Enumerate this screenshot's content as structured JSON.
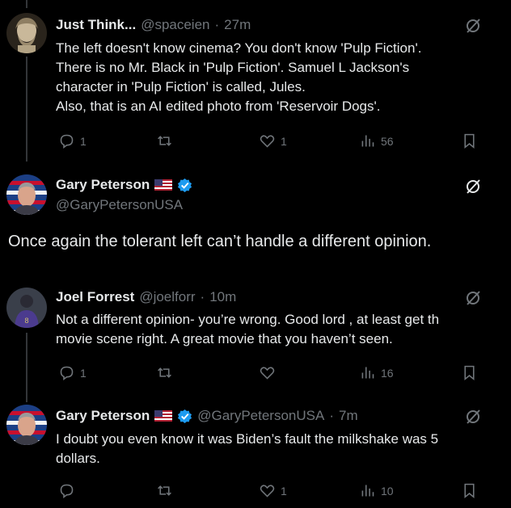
{
  "posts": [
    {
      "display_name": "Just Think...",
      "handle": "@spaceien",
      "time": "27m",
      "text_lines": [
        "The left doesn't know cinema? You don't know 'Pulp Fiction'.",
        "There is no Mr. Black in 'Pulp Fiction'. Samuel L Jackson's",
        "character in 'Pulp Fiction' is called, Jules.",
        "Also, that is an AI edited photo from 'Reservoir Dogs'."
      ],
      "replies": "1",
      "reposts": "",
      "likes": "1",
      "views": "56"
    },
    {
      "display_name": "Gary Peterson",
      "handle": "@GaryPetersonUSA",
      "text": "Once again the tolerant left can’t handle a different opinion."
    },
    {
      "display_name": "Joel Forrest",
      "handle": "@joelforr",
      "time": "10m",
      "text_lines": [
        "Not a different opinion- you’re wrong. Good lord , at least get th",
        "movie scene right. A great movie that you haven’t seen."
      ],
      "replies": "1",
      "reposts": "",
      "likes": "",
      "views": "16"
    },
    {
      "display_name": "Gary Peterson",
      "handle": "@GaryPetersonUSA",
      "time": "7m",
      "text_lines": [
        "I doubt you even know it was Biden’s fault the milkshake was 5",
        "dollars."
      ],
      "replies": "",
      "reposts": "",
      "likes": "1",
      "views": "10"
    }
  ],
  "separator": "·",
  "icons": {
    "reply": "reply-icon",
    "repost": "repost-icon",
    "like": "like-icon",
    "views": "views-icon",
    "bookmark": "bookmark-icon",
    "grok": "grok-icon",
    "verified": "verified-badge-icon",
    "flag": "us-flag-icon"
  },
  "colors": {
    "background": "#000000",
    "text": "#e7e9ea",
    "muted": "#71767b",
    "verified": "#1d9bf0"
  }
}
